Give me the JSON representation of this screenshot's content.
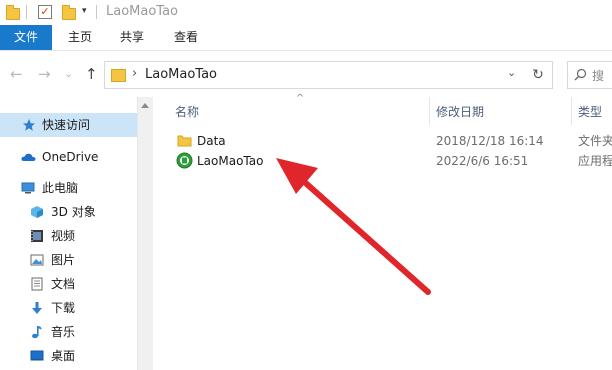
{
  "window": {
    "title": "LaoMaoTao"
  },
  "titlebar": {
    "dropdown_glyph": "▾"
  },
  "ribbon": {
    "tabs": [
      {
        "label": "文件"
      },
      {
        "label": "主页"
      },
      {
        "label": "共享"
      },
      {
        "label": "查看"
      }
    ]
  },
  "address": {
    "back": "←",
    "forward": "→",
    "recent": "⌄",
    "up": "↑",
    "separator": "›",
    "path": "LaoMaoTao",
    "expand": "⌄",
    "refresh": "↻",
    "search_placeholder": "搜"
  },
  "nav": {
    "quick_access": "快速访问",
    "onedrive": "OneDrive",
    "this_pc": "此电脑",
    "items": [
      {
        "label": "3D 对象",
        "icon": "3d-objects-icon"
      },
      {
        "label": "视频",
        "icon": "video-icon"
      },
      {
        "label": "图片",
        "icon": "pictures-icon"
      },
      {
        "label": "文档",
        "icon": "documents-icon"
      },
      {
        "label": "下载",
        "icon": "downloads-icon"
      },
      {
        "label": "音乐",
        "icon": "music-icon"
      },
      {
        "label": "桌面",
        "icon": "desktop-icon"
      }
    ]
  },
  "list": {
    "sort_glyph": "^",
    "columns": {
      "name": "名称",
      "date": "修改日期",
      "type": "类型"
    },
    "rows": [
      {
        "name": "Data",
        "date": "2018/12/18 16:14",
        "type": "文件夹",
        "icon": "folder-icon"
      },
      {
        "name": "LaoMaoTao",
        "date": "2022/6/6 16:51",
        "type": "应用程",
        "icon": "app-icon"
      }
    ]
  },
  "colors": {
    "accent": "#1979ca",
    "selected": "#cce4f7",
    "arrow": "#e0262b",
    "folder": "#f4c542"
  }
}
